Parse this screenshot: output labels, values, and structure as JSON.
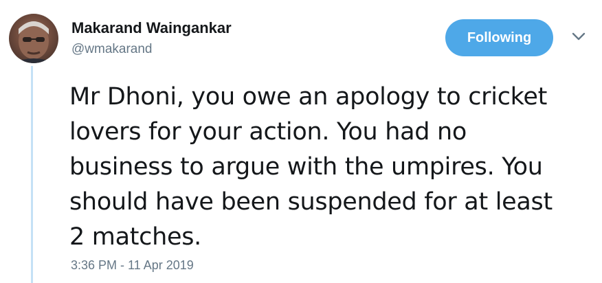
{
  "tweet": {
    "author": {
      "display_name": "Makarand Waingankar",
      "handle": "@wmakarand"
    },
    "follow_button_label": "Following",
    "text_lines": [
      "Mr Dhoni, you owe an apology to cricket",
      "lovers for your action. You had no",
      "business to argue with the umpires. You",
      "should have been suspended for at least",
      "2 matches."
    ],
    "timestamp": "3:36 PM - 11 Apr 2019"
  },
  "colors": {
    "accent": "#4ea8e8",
    "secondary_text": "#657786",
    "thread_line": "#c4e1f6"
  },
  "icons": {
    "caret": "chevron-down-icon",
    "avatar": "avatar"
  }
}
